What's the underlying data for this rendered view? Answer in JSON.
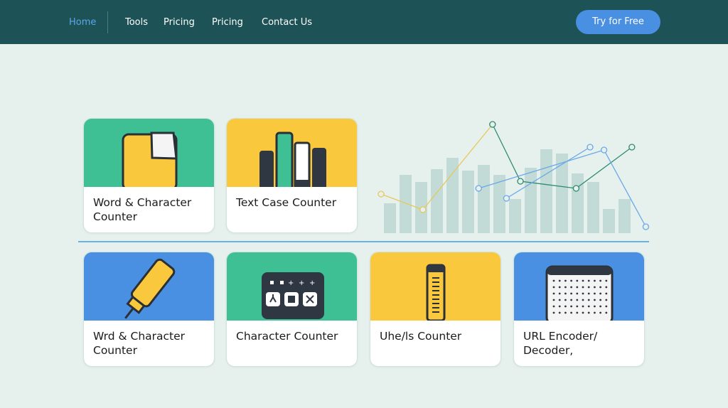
{
  "nav": {
    "items": [
      {
        "label": "Home",
        "active": true
      },
      {
        "label": "Tools",
        "active": false
      },
      {
        "label": "Pricing",
        "active": false
      },
      {
        "label": "Pricing",
        "active": false
      },
      {
        "label": "Contact Us",
        "active": false
      }
    ],
    "cta_label": "Try for Free"
  },
  "cards": [
    {
      "title": "Word & Character Counter",
      "art_color": "#3fbf94",
      "icon": "document-icon"
    },
    {
      "title": "Text Case Counter",
      "art_color": "#fac83c",
      "icon": "bar-chart-icon"
    },
    {
      "title": "Wrd & Character Counter",
      "art_color": "#4a90e2",
      "icon": "highlighter-icon"
    },
    {
      "title": "Character Counter",
      "art_color": "#3fbf94",
      "icon": "keypad-icon"
    },
    {
      "title": "Uhe/ls Counter",
      "art_color": "#fac83c",
      "icon": "ruler-icon"
    },
    {
      "title": "URL Encoder/ Decoder,",
      "art_color": "#4a90e2",
      "icon": "dot-grid-icon"
    }
  ],
  "colors": {
    "navbar": "#1d5356",
    "accent": "#4a90e2",
    "green": "#3fbf94",
    "yellow": "#fac83c",
    "page": "#e6f1ee"
  },
  "chart_data": {
    "type": "bar",
    "values": [
      42,
      82,
      72,
      90,
      106,
      88,
      96,
      82,
      48,
      92,
      118,
      112,
      84,
      72,
      34,
      48
    ],
    "series": [
      {
        "values": [
          [
            0,
            52
          ],
          [
            3,
            30
          ],
          [
            8,
            150
          ]
        ]
      },
      {
        "values": [
          [
            8,
            150
          ],
          [
            10,
            70
          ],
          [
            14,
            60
          ],
          [
            18,
            118
          ]
        ]
      },
      {
        "values": [
          [
            9,
            46
          ],
          [
            15,
            118
          ]
        ]
      },
      {
        "values": [
          [
            7,
            60
          ],
          [
            16,
            114
          ],
          [
            19,
            6
          ]
        ]
      }
    ],
    "grid": false
  }
}
